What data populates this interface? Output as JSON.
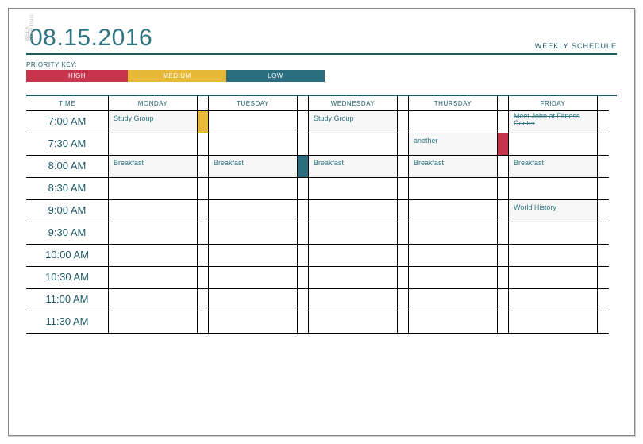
{
  "header": {
    "week_starting_label": "WEEK STARTING",
    "date": "08.15.2016",
    "title": "WEEKLY SCHEDULE"
  },
  "priority": {
    "label": "PRIORITY KEY:",
    "high": "HIGH",
    "medium": "MEDIUM",
    "low": "LOW",
    "colors": {
      "high": "#c7354d",
      "medium": "#e8b837",
      "low": "#2b6e80"
    }
  },
  "columns": {
    "time": "TIME",
    "mon": "MONDAY",
    "tue": "TUESDAY",
    "wed": "WEDNESDAY",
    "thu": "THURSDAY",
    "fri": "FRIDAY"
  },
  "times": [
    "7:00 AM",
    "7:30 AM",
    "8:00 AM",
    "8:30 AM",
    "9:00 AM",
    "9:30 AM",
    "10:00 AM",
    "10:30 AM",
    "11:00 AM",
    "11:30 AM"
  ],
  "events": {
    "r0": {
      "mon": "Study Group",
      "wed": "Study Group",
      "fri": "Meet John at Fitness Center",
      "mon_flag": "medium"
    },
    "r1": {
      "thu": "another",
      "thu_flag": "high"
    },
    "r2": {
      "mon": "Breakfast",
      "tue": "Breakfast",
      "wed": "Breakfast",
      "thu": "Breakfast",
      "fri": "Breakfast",
      "tue_flag": "low"
    },
    "r4": {
      "fri": "World History"
    }
  }
}
